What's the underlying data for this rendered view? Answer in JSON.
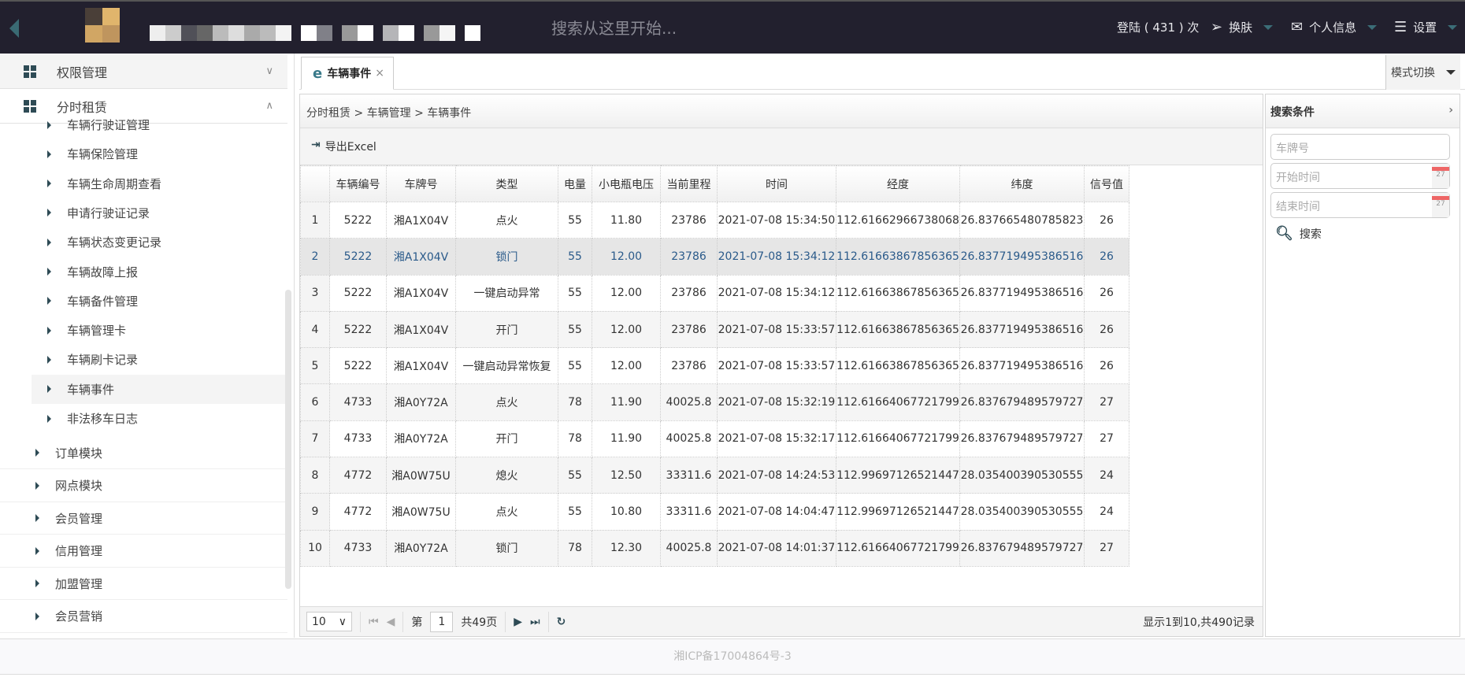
{
  "header": {
    "search_placeholder": "搜索从这里开始...",
    "login_count": "登陆 ( 431 ) 次",
    "skin": "换肤",
    "profile": "个人信息",
    "settings": "设置"
  },
  "sidebar": {
    "groups": [
      {
        "label": "权限管理",
        "expanded": false
      },
      {
        "label": "分时租赁",
        "expanded": true
      }
    ],
    "sub_items": [
      "车辆行驶证管理",
      "车辆保险管理",
      "车辆生命周期查看",
      "申请行驶证记录",
      "车辆状态变更记录",
      "车辆故障上报",
      "车辆备件管理",
      "车辆管理卡",
      "车辆刷卡记录",
      "车辆事件",
      "非法移车日志"
    ],
    "active_sub": "车辆事件",
    "modules": [
      "订单模块",
      "网点模块",
      "会员管理",
      "信用管理",
      "加盟管理",
      "会员营销"
    ]
  },
  "tabs": [
    {
      "label": "车辆事件",
      "close": "×"
    }
  ],
  "mode_switch": "模式切换",
  "breadcrumb": "分时租赁 > 车辆管理 > 车辆事件",
  "toolbar": {
    "export": "导出Excel"
  },
  "table": {
    "columns": [
      "",
      "车辆编号",
      "车牌号",
      "类型",
      "电量",
      "小电瓶电压",
      "当前里程",
      "时间",
      "经度",
      "纬度",
      "信号值"
    ],
    "rows": [
      [
        "1",
        "5222",
        "湘A1X04V",
        "点火",
        "55",
        "11.80",
        "23786",
        "2021-07-08 15:34:50",
        "112.61662966738068",
        "26.837665480785823",
        "26"
      ],
      [
        "2",
        "5222",
        "湘A1X04V",
        "锁门",
        "55",
        "12.00",
        "23786",
        "2021-07-08 15:34:12",
        "112.61663867856365",
        "26.837719495386516",
        "26"
      ],
      [
        "3",
        "5222",
        "湘A1X04V",
        "一键启动异常",
        "55",
        "12.00",
        "23786",
        "2021-07-08 15:34:12",
        "112.61663867856365",
        "26.837719495386516",
        "26"
      ],
      [
        "4",
        "5222",
        "湘A1X04V",
        "开门",
        "55",
        "12.00",
        "23786",
        "2021-07-08 15:33:57",
        "112.61663867856365",
        "26.837719495386516",
        "26"
      ],
      [
        "5",
        "5222",
        "湘A1X04V",
        "一键启动异常恢复",
        "55",
        "12.00",
        "23786",
        "2021-07-08 15:33:57",
        "112.61663867856365",
        "26.837719495386516",
        "26"
      ],
      [
        "6",
        "4733",
        "湘A0Y72A",
        "点火",
        "78",
        "11.90",
        "40025.8",
        "2021-07-08 15:32:19",
        "112.61664067721799",
        "26.837679489579727",
        "27"
      ],
      [
        "7",
        "4733",
        "湘A0Y72A",
        "开门",
        "78",
        "11.90",
        "40025.8",
        "2021-07-08 15:32:17",
        "112.61664067721799",
        "26.837679489579727",
        "27"
      ],
      [
        "8",
        "4772",
        "湘A0W75U",
        "熄火",
        "55",
        "12.50",
        "33311.6",
        "2021-07-08 14:24:53",
        "112.9969712652144​7",
        "28.035400390530555",
        "24"
      ],
      [
        "9",
        "4772",
        "湘A0W75U",
        "点火",
        "55",
        "10.80",
        "33311.6",
        "2021-07-08 14:04:47",
        "112.99697126521447",
        "28.035400390530555",
        "24"
      ],
      [
        "10",
        "4733",
        "湘A0Y72A",
        "锁门",
        "78",
        "12.30",
        "40025.8",
        "2021-07-08 14:01:37",
        "112.61664067721799",
        "26.837679489579727",
        "27"
      ]
    ],
    "selected_row": 2
  },
  "pager": {
    "page_size": "10",
    "page_prefix": "第",
    "page": "1",
    "page_total": "共49页",
    "info": "显示1到10,共490记录"
  },
  "search_panel": {
    "title": "搜索条件",
    "plate_placeholder": "车牌号",
    "start_placeholder": "开始时间",
    "end_placeholder": "结束时间",
    "calendar_day": "27",
    "search": "搜索"
  },
  "footer": {
    "icp": "湘ICP备17004864号-3"
  },
  "colors": {
    "header_bg": "#22202e",
    "accent": "#2e4b55",
    "selected_text": "#2a5a8a"
  }
}
